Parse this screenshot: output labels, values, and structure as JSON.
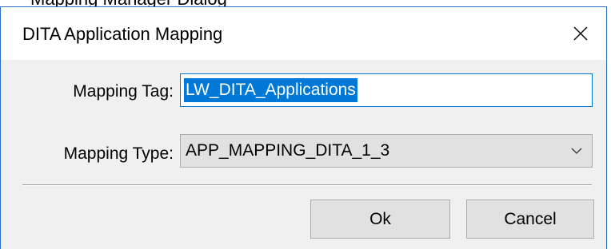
{
  "background_window": {
    "partial_text": "Mapping Manager Dialog"
  },
  "dialog": {
    "title": "DITA Application Mapping",
    "close_icon": "close-icon",
    "mapping_tag": {
      "label": "Mapping Tag:",
      "value": "LW_DITA_Applications",
      "selected": true
    },
    "mapping_type": {
      "label": "Mapping Type:",
      "selected_value": "APP_MAPPING_DITA_1_3",
      "dropdown_icon": "chevron-down-icon"
    },
    "buttons": {
      "ok": "Ok",
      "cancel": "Cancel"
    }
  },
  "colors": {
    "accent": "#0078d7",
    "window_border": "#2b6cc4",
    "dialog_bg": "#f0f0f0",
    "button_bg": "#e1e1e1"
  }
}
